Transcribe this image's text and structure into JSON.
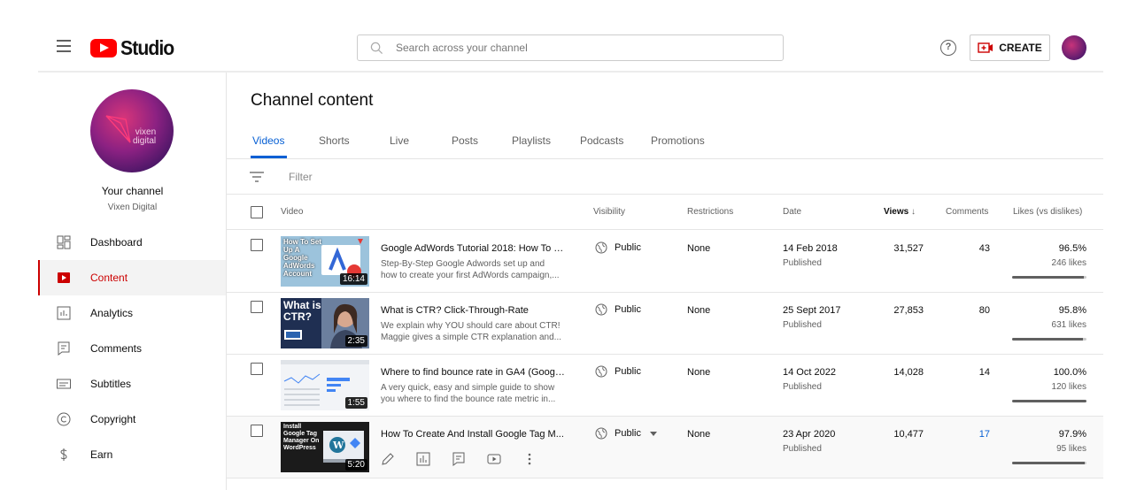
{
  "header": {
    "logo_text": "Studio",
    "search_placeholder": "Search across your channel",
    "help_label": "?",
    "create_label": "CREATE"
  },
  "sidebar": {
    "channel_title": "Your channel",
    "channel_name": "Vixen Digital",
    "avatar_text_1": "vixen",
    "avatar_text_2": "digital",
    "items": [
      {
        "label": "Dashboard",
        "icon": "dashboard-icon"
      },
      {
        "label": "Content",
        "icon": "content-icon",
        "active": true
      },
      {
        "label": "Analytics",
        "icon": "analytics-icon"
      },
      {
        "label": "Comments",
        "icon": "comments-icon"
      },
      {
        "label": "Subtitles",
        "icon": "subtitles-icon"
      },
      {
        "label": "Copyright",
        "icon": "copyright-icon"
      },
      {
        "label": "Earn",
        "icon": "earn-icon"
      }
    ]
  },
  "main": {
    "title": "Channel content",
    "tabs": [
      "Videos",
      "Shorts",
      "Live",
      "Posts",
      "Playlists",
      "Podcasts",
      "Promotions"
    ],
    "filter_placeholder": "Filter",
    "columns": {
      "video": "Video",
      "visibility": "Visibility",
      "restrictions": "Restrictions",
      "date": "Date",
      "views": "Views",
      "sort_arrow": "↓",
      "comments": "Comments",
      "likes": "Likes (vs dislikes)"
    },
    "rows": [
      {
        "thumb_text": "How To Set Up A Google AdWords Account",
        "duration": "16:14",
        "title": "Google AdWords Tutorial 2018: How To S...",
        "desc_1": "Step-By-Step Google Adwords set up and",
        "desc_2": "how to create your first AdWords campaign,...",
        "visibility": "Public",
        "restrictions": "None",
        "date": "14 Feb 2018",
        "status": "Published",
        "views": "31,527",
        "comments": "43",
        "likes_pct": "96.5%",
        "likes_count": "246 likes",
        "likes_ratio": 0.965
      },
      {
        "thumb_text": "What is CTR?",
        "duration": "2:35",
        "title": "What is CTR? Click-Through-Rate",
        "desc_1": "We explain why YOU should care about CTR!",
        "desc_2": "Maggie gives a simple CTR explanation and...",
        "visibility": "Public",
        "restrictions": "None",
        "date": "25 Sept 2017",
        "status": "Published",
        "views": "27,853",
        "comments": "80",
        "likes_pct": "95.8%",
        "likes_count": "631 likes",
        "likes_ratio": 0.958
      },
      {
        "thumb_text": "",
        "duration": "1:55",
        "title": "Where to find bounce rate in GA4 (Google...",
        "desc_1": "A very quick, easy and simple guide to show",
        "desc_2": "you where to find the bounce rate metric in...",
        "visibility": "Public",
        "restrictions": "None",
        "date": "14 Oct 2022",
        "status": "Published",
        "views": "14,028",
        "comments": "14",
        "likes_pct": "100.0%",
        "likes_count": "120 likes",
        "likes_ratio": 1.0
      },
      {
        "thumb_text": "Install Google Tag Manager On WordPress",
        "duration": "5:20",
        "title": "How To Create And Install Google Tag M...",
        "visibility": "Public",
        "restrictions": "None",
        "date": "23 Apr 2020",
        "status": "Published",
        "views": "10,477",
        "comments": "17",
        "likes_pct": "97.9%",
        "likes_count": "95 likes",
        "likes_ratio": 0.979
      }
    ]
  },
  "colors": {
    "accent_red": "#cc0000",
    "link_blue": "#065fd4"
  }
}
